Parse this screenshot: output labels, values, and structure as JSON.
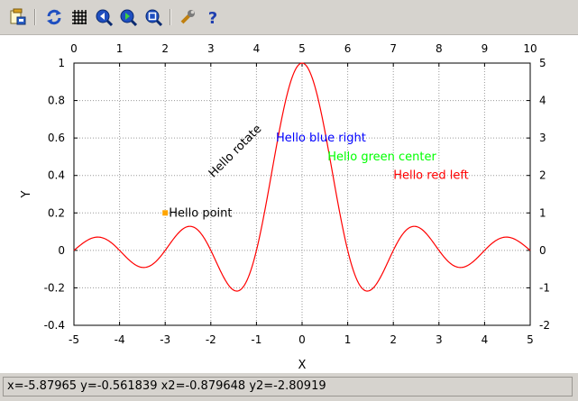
{
  "toolbar": {
    "buttons": [
      {
        "icon": "load-icon"
      },
      {
        "icon": "refresh-icon"
      },
      {
        "icon": "grid-icon"
      },
      {
        "icon": "zoom-out-icon"
      },
      {
        "icon": "zoom-in-icon"
      },
      {
        "icon": "zoom-fit-icon"
      },
      {
        "icon": "settings-icon"
      },
      {
        "icon": "help-icon"
      }
    ]
  },
  "status": {
    "text": "x=-5.87965 y=-0.561839 x2=-0.879648 y2=-2.80919"
  },
  "chart_data": {
    "type": "line",
    "title": "",
    "xlabel": "X",
    "ylabel": "Y",
    "xlim": [
      -5,
      5
    ],
    "ylim": [
      -0.4,
      1
    ],
    "x2lim": [
      0,
      10
    ],
    "y2lim": [
      -2,
      5
    ],
    "xticks": [
      "-5",
      "-4",
      "-3",
      "-2",
      "-1",
      "0",
      "1",
      "2",
      "3",
      "4",
      "5"
    ],
    "yticks": [
      "-0.4",
      "-0.2",
      "0",
      "0.2",
      "0.4",
      "0.6",
      "0.8",
      "1"
    ],
    "x2ticks": [
      "0",
      "1",
      "2",
      "3",
      "4",
      "5",
      "6",
      "7",
      "8",
      "9",
      "10"
    ],
    "y2ticks": [
      "-2",
      "-1",
      "0",
      "1",
      "2",
      "3",
      "4",
      "5"
    ],
    "grid": true,
    "series": [
      {
        "color": "#ff0000",
        "function": "sin(pi*x)/(pi*x)",
        "x": [
          -5,
          5
        ]
      }
    ],
    "point": {
      "x": -3,
      "y": 0.2,
      "color": "#ffa500"
    },
    "annotations": [
      {
        "text": "Hello point",
        "x": -2.92,
        "y": 0.2,
        "align": "left",
        "color": "#000000",
        "rotate": 0
      },
      {
        "text": "Hello rotate",
        "x": -2,
        "y": 0.4,
        "align": "left",
        "color": "#000000",
        "rotate": -45
      },
      {
        "text": "Hello blue right",
        "x": 1.4,
        "y": 0.6,
        "align": "right",
        "color": "#0000ff",
        "rotate": 0
      },
      {
        "text": "Hello green center",
        "x": 1.75,
        "y": 0.5,
        "align": "center",
        "color": "#00ff00",
        "rotate": 0
      },
      {
        "text": "Hello red left",
        "x": 2.0,
        "y": 0.4,
        "align": "left",
        "color": "#ff0000",
        "rotate": 0
      }
    ]
  }
}
